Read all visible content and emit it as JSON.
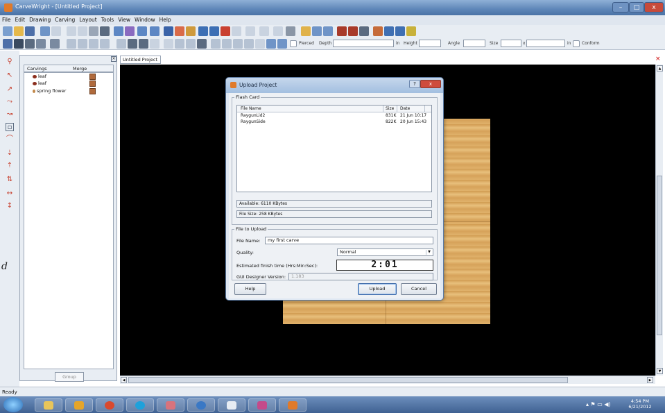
{
  "window": {
    "title": "CarveWright - [Untitled Project]",
    "minimize_glyph": "–",
    "maximize_glyph": "□",
    "close_glyph": "x"
  },
  "menubar": {
    "items": [
      "File",
      "Edit",
      "Drawing",
      "Carving",
      "Layout",
      "Tools",
      "View",
      "Window",
      "Help"
    ]
  },
  "toolbar2": {
    "pierced_label": "Pierced",
    "depth_label": "Depth",
    "in_label": "in",
    "height_label": "Height",
    "angle_label": "Angle",
    "size_label": "Size",
    "x_label": "x",
    "in2_label": "in",
    "conform_label": "Conform"
  },
  "panel": {
    "col_carvings": "Carvings",
    "col_merge": "Merge",
    "items": [
      "leaf",
      "leaf",
      "spring flower"
    ],
    "group_button": "Group"
  },
  "document": {
    "tab_label": "Untitled Project",
    "close_glyph": "×"
  },
  "side_text": "d",
  "dialog": {
    "title": "Upload Project",
    "help_glyph": "?",
    "close_glyph": "x",
    "flash_card_label": "Flash Card",
    "columns": {
      "name": "File Name",
      "size": "Size",
      "date": "Date"
    },
    "files": [
      {
        "name": "RaygunLid2",
        "size": "831K",
        "date": "21 Jun 10:17"
      },
      {
        "name": "RaygunSide",
        "size": "822K",
        "date": "20 Jun 15:43"
      }
    ],
    "available": "Available: 6110 KBytes",
    "file_size": "File Size: 258 KBytes",
    "file_to_upload_label": "File to Upload",
    "file_name_label": "File Name:",
    "file_name_value": "my first carve",
    "quality_label": "Quality:",
    "quality_value": "Normal",
    "est_time_label": "Estimated finish time (Hrs:Min:Sec):",
    "est_time_value": "2:01",
    "gui_version_label": "GUI Designer Version:",
    "gui_version_value": "1.183",
    "help_button": "Help",
    "upload_button": "Upload",
    "cancel_button": "Cancel"
  },
  "status": {
    "text": "Ready"
  },
  "taskbar": {
    "time": "4:54 PM",
    "date": "6/21/2012"
  }
}
